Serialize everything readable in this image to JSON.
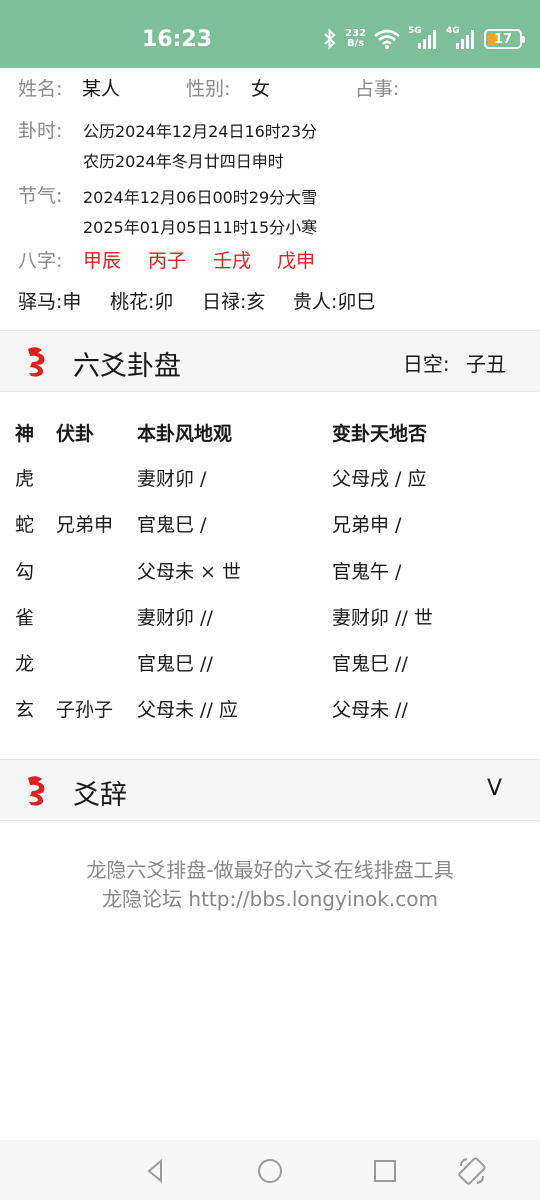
{
  "status": {
    "time": "16:23",
    "speed_value": "232",
    "speed_unit": "B/s",
    "net1": "5G",
    "net2": "4G",
    "battery": "17"
  },
  "info": {
    "name_label": "姓名:",
    "name_value": "某人",
    "gender_label": "性别:",
    "gender_value": "女",
    "matter_label": "占事:",
    "time_label": "卦时:",
    "solar_time": "公历2024年12月24日16时23分",
    "lunar_time": "农历2024年冬月廿四日申时",
    "term_label": "节气:",
    "term1": "2024年12月06日00时29分大雪",
    "term2": "2025年01月05日11时15分小寒",
    "bazi_label": "八字:",
    "bazi": [
      "甲辰",
      "丙子",
      "壬戌",
      "戊申"
    ],
    "stars": [
      "驿马:申",
      "桃花:卯",
      "日禄:亥",
      "贵人:卯巳"
    ]
  },
  "panel": {
    "title": "六爻卦盘",
    "void_label": "日空:",
    "void_value": "子丑"
  },
  "table": {
    "headers": [
      "神",
      "伏卦",
      "本卦风地观",
      "变卦天地否"
    ],
    "rows": [
      [
        "虎",
        "",
        "妻财卯  /",
        "父母戌  /  应"
      ],
      [
        "蛇",
        "兄弟申",
        "官鬼巳  /",
        "兄弟申  /"
      ],
      [
        "勾",
        "",
        "父母未 × 世",
        "官鬼午  /"
      ],
      [
        "雀",
        "",
        "妻财卯 //",
        "妻财卯 // 世"
      ],
      [
        "龙",
        "",
        "官鬼巳 //",
        "官鬼巳 //"
      ],
      [
        "玄",
        "子孙子",
        "父母未 // 应",
        "父母未 //"
      ]
    ]
  },
  "yaoci": {
    "title": "爻辞",
    "toggle": "V"
  },
  "footer": {
    "line1": "龙隐六爻排盘-做最好的六爻在线排盘工具",
    "line2": "龙隐论坛 http://bbs.longyinok.com"
  },
  "colors": {
    "statusbar": "#7dbf98",
    "bazi": "#e02020",
    "logo": "#e02020"
  }
}
